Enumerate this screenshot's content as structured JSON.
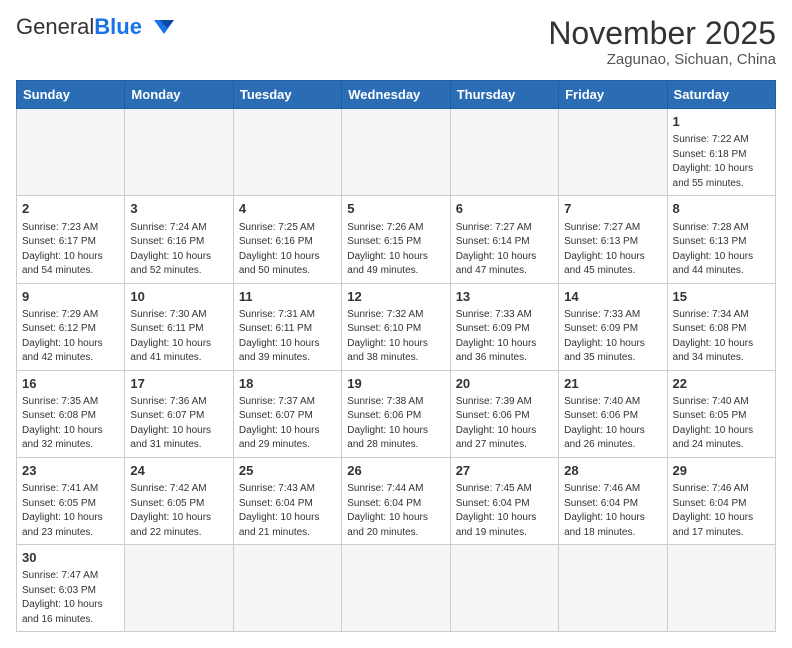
{
  "logo": {
    "text_general": "General",
    "text_blue": "Blue"
  },
  "title": "November 2025",
  "location": "Zagunao, Sichuan, China",
  "weekdays": [
    "Sunday",
    "Monday",
    "Tuesday",
    "Wednesday",
    "Thursday",
    "Friday",
    "Saturday"
  ],
  "weeks": [
    [
      {
        "day": "",
        "info": ""
      },
      {
        "day": "",
        "info": ""
      },
      {
        "day": "",
        "info": ""
      },
      {
        "day": "",
        "info": ""
      },
      {
        "day": "",
        "info": ""
      },
      {
        "day": "",
        "info": ""
      },
      {
        "day": "1",
        "info": "Sunrise: 7:22 AM\nSunset: 6:18 PM\nDaylight: 10 hours and 55 minutes."
      }
    ],
    [
      {
        "day": "2",
        "info": "Sunrise: 7:23 AM\nSunset: 6:17 PM\nDaylight: 10 hours and 54 minutes."
      },
      {
        "day": "3",
        "info": "Sunrise: 7:24 AM\nSunset: 6:16 PM\nDaylight: 10 hours and 52 minutes."
      },
      {
        "day": "4",
        "info": "Sunrise: 7:25 AM\nSunset: 6:16 PM\nDaylight: 10 hours and 50 minutes."
      },
      {
        "day": "5",
        "info": "Sunrise: 7:26 AM\nSunset: 6:15 PM\nDaylight: 10 hours and 49 minutes."
      },
      {
        "day": "6",
        "info": "Sunrise: 7:27 AM\nSunset: 6:14 PM\nDaylight: 10 hours and 47 minutes."
      },
      {
        "day": "7",
        "info": "Sunrise: 7:27 AM\nSunset: 6:13 PM\nDaylight: 10 hours and 45 minutes."
      },
      {
        "day": "8",
        "info": "Sunrise: 7:28 AM\nSunset: 6:13 PM\nDaylight: 10 hours and 44 minutes."
      }
    ],
    [
      {
        "day": "9",
        "info": "Sunrise: 7:29 AM\nSunset: 6:12 PM\nDaylight: 10 hours and 42 minutes."
      },
      {
        "day": "10",
        "info": "Sunrise: 7:30 AM\nSunset: 6:11 PM\nDaylight: 10 hours and 41 minutes."
      },
      {
        "day": "11",
        "info": "Sunrise: 7:31 AM\nSunset: 6:11 PM\nDaylight: 10 hours and 39 minutes."
      },
      {
        "day": "12",
        "info": "Sunrise: 7:32 AM\nSunset: 6:10 PM\nDaylight: 10 hours and 38 minutes."
      },
      {
        "day": "13",
        "info": "Sunrise: 7:33 AM\nSunset: 6:09 PM\nDaylight: 10 hours and 36 minutes."
      },
      {
        "day": "14",
        "info": "Sunrise: 7:33 AM\nSunset: 6:09 PM\nDaylight: 10 hours and 35 minutes."
      },
      {
        "day": "15",
        "info": "Sunrise: 7:34 AM\nSunset: 6:08 PM\nDaylight: 10 hours and 34 minutes."
      }
    ],
    [
      {
        "day": "16",
        "info": "Sunrise: 7:35 AM\nSunset: 6:08 PM\nDaylight: 10 hours and 32 minutes."
      },
      {
        "day": "17",
        "info": "Sunrise: 7:36 AM\nSunset: 6:07 PM\nDaylight: 10 hours and 31 minutes."
      },
      {
        "day": "18",
        "info": "Sunrise: 7:37 AM\nSunset: 6:07 PM\nDaylight: 10 hours and 29 minutes."
      },
      {
        "day": "19",
        "info": "Sunrise: 7:38 AM\nSunset: 6:06 PM\nDaylight: 10 hours and 28 minutes."
      },
      {
        "day": "20",
        "info": "Sunrise: 7:39 AM\nSunset: 6:06 PM\nDaylight: 10 hours and 27 minutes."
      },
      {
        "day": "21",
        "info": "Sunrise: 7:40 AM\nSunset: 6:06 PM\nDaylight: 10 hours and 26 minutes."
      },
      {
        "day": "22",
        "info": "Sunrise: 7:40 AM\nSunset: 6:05 PM\nDaylight: 10 hours and 24 minutes."
      }
    ],
    [
      {
        "day": "23",
        "info": "Sunrise: 7:41 AM\nSunset: 6:05 PM\nDaylight: 10 hours and 23 minutes."
      },
      {
        "day": "24",
        "info": "Sunrise: 7:42 AM\nSunset: 6:05 PM\nDaylight: 10 hours and 22 minutes."
      },
      {
        "day": "25",
        "info": "Sunrise: 7:43 AM\nSunset: 6:04 PM\nDaylight: 10 hours and 21 minutes."
      },
      {
        "day": "26",
        "info": "Sunrise: 7:44 AM\nSunset: 6:04 PM\nDaylight: 10 hours and 20 minutes."
      },
      {
        "day": "27",
        "info": "Sunrise: 7:45 AM\nSunset: 6:04 PM\nDaylight: 10 hours and 19 minutes."
      },
      {
        "day": "28",
        "info": "Sunrise: 7:46 AM\nSunset: 6:04 PM\nDaylight: 10 hours and 18 minutes."
      },
      {
        "day": "29",
        "info": "Sunrise: 7:46 AM\nSunset: 6:04 PM\nDaylight: 10 hours and 17 minutes."
      }
    ],
    [
      {
        "day": "30",
        "info": "Sunrise: 7:47 AM\nSunset: 6:03 PM\nDaylight: 10 hours and 16 minutes."
      },
      {
        "day": "",
        "info": ""
      },
      {
        "day": "",
        "info": ""
      },
      {
        "day": "",
        "info": ""
      },
      {
        "day": "",
        "info": ""
      },
      {
        "day": "",
        "info": ""
      },
      {
        "day": "",
        "info": ""
      }
    ]
  ]
}
